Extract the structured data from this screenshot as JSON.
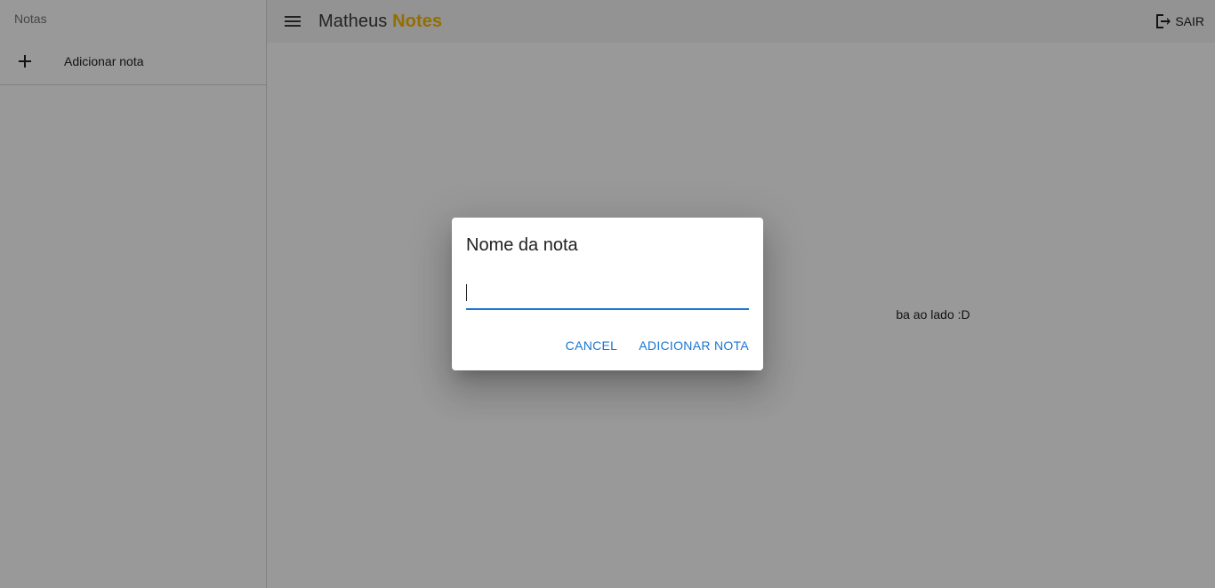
{
  "sidebar": {
    "header": "Notas",
    "items": [
      {
        "icon": "plus-icon",
        "label": "Adicionar nota"
      }
    ]
  },
  "appbar": {
    "menu_icon": "menu-icon",
    "title_main": "Matheus",
    "title_accent": "Notes",
    "title_accent_color": "#f5b700",
    "logout_icon": "exit-icon",
    "logout_label": "SAIR"
  },
  "main": {
    "visible_message": "ba ao lado :D"
  },
  "dialog": {
    "title": "Nome da nota",
    "input_value": "",
    "cancel_label": "CANCEL",
    "confirm_label": "ADICIONAR NOTA",
    "accent_color": "#1976d2"
  }
}
